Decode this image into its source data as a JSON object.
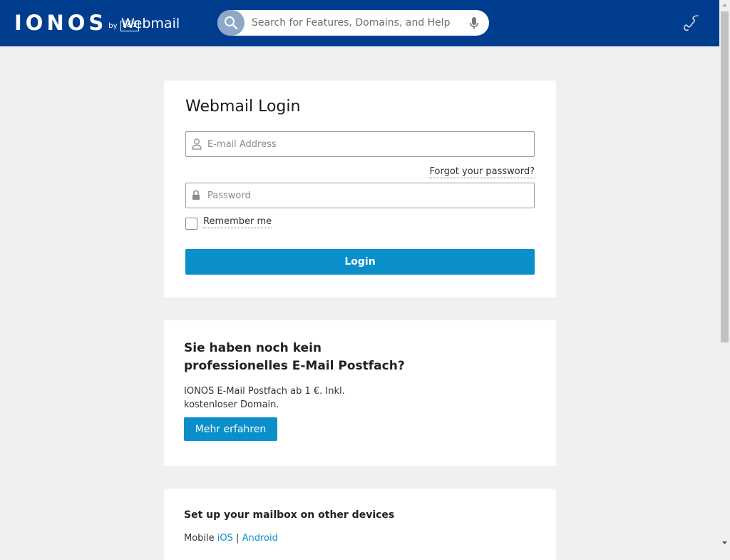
{
  "header": {
    "logo_text": "IONOS",
    "logo_by": "by",
    "logo_partner": "1&1",
    "app_title": "Webmail",
    "search_placeholder": "Search for Features, Domains, and Help"
  },
  "login": {
    "title": "Webmail Login",
    "email_placeholder": "E-mail Address",
    "email_value": "",
    "forgot_label": "Forgot your password?",
    "password_placeholder": "Password",
    "password_value": "",
    "remember_label": "Remember me",
    "remember_checked": false,
    "submit_label": "Login"
  },
  "promo": {
    "title": "Sie haben noch kein professionelles E-Mail Postfach?",
    "text": "IONOS E-Mail Postfach ab 1 €. Inkl. kostenloser Domain.",
    "button_label": "Mehr erfahren"
  },
  "devices": {
    "title": "Set up your mailbox on other devices",
    "mobile_label": "Mobile",
    "ios_label": "iOS",
    "separator": "|",
    "android_label": "Android"
  },
  "colors": {
    "header_bg": "#003d8f",
    "accent": "#0b8fcb",
    "page_bg": "#f0f0f0"
  },
  "icons": {
    "search": "search-icon",
    "mic": "microphone-icon",
    "phone": "phone-icon",
    "user": "user-icon",
    "lock": "lock-icon"
  }
}
